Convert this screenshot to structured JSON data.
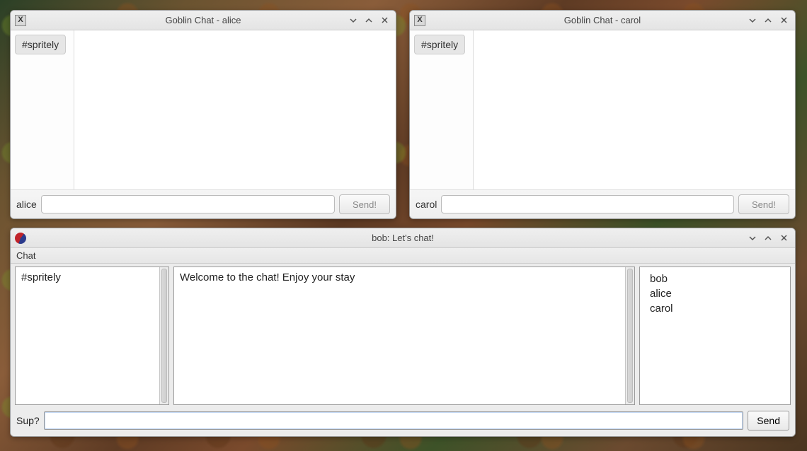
{
  "windows": {
    "alice": {
      "title": "Goblin Chat - alice",
      "channel": "#spritely",
      "username": "alice",
      "send_label": "Send!"
    },
    "carol": {
      "title": "Goblin Chat - carol",
      "channel": "#spritely",
      "username": "carol",
      "send_label": "Send!"
    },
    "bob": {
      "title": "bob: Let's chat!",
      "menu_chat": "Chat",
      "channel": "#spritely",
      "welcome": "Welcome to the chat!  Enjoy your stay",
      "users": {
        "u0": "bob",
        "u1": "alice",
        "u2": "carol"
      },
      "input_label": "Sup?",
      "send_label": "Send"
    }
  },
  "icons": {
    "x_label": "X"
  }
}
